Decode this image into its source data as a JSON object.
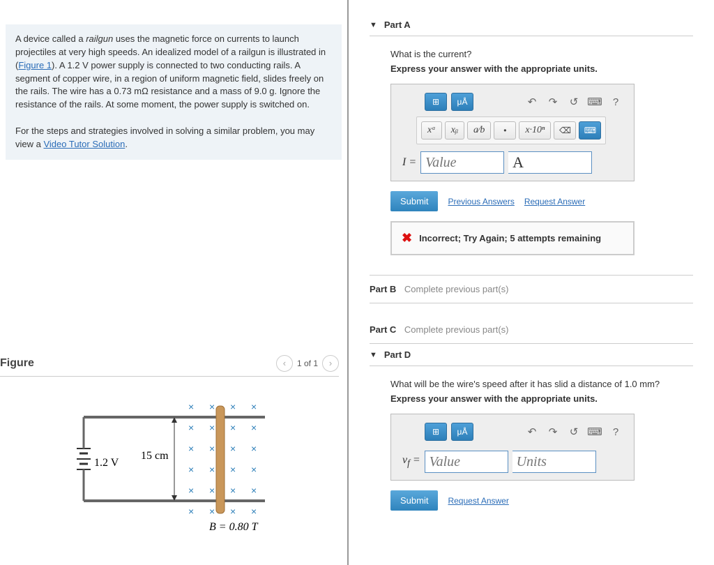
{
  "intro": {
    "text": "A device called a railgun uses the magnetic force on currents to launch projectiles at very high speeds. An idealized model of a railgun is illustrated in (Figure 1). A 1.2 V power supply is connected to two conducting rails. A segment of copper wire, in a region of uniform magnetic field, slides freely on the rails. The wire has a 0.73 mΩ resistance and a mass of 9.0 g. Ignore the resistance of the rails. At some moment, the power supply is switched on.",
    "figure_link": "Figure 1",
    "steps_prefix": "For the steps and strategies involved in solving a similar problem, you may view a ",
    "video_link": "Video Tutor Solution",
    "steps_suffix": "."
  },
  "figure": {
    "title": "Figure",
    "pager": "1 of 1",
    "labels": {
      "voltage": "1.2 V",
      "length": "15 cm",
      "field": "B = 0.80 T"
    }
  },
  "partA": {
    "label": "Part A",
    "prompt": "What is the current?",
    "express": "Express your answer with the appropriate units.",
    "var": "I =",
    "value_ph": "Value",
    "unit_val": "A",
    "tb": {
      "units": "μÅ",
      "sup": "xᵃ",
      "sub": "xᵦ",
      "frac": "a⁄b",
      "dot": "•",
      "sci": "x·10ⁿ"
    },
    "submit": "Submit",
    "prev": "Previous Answers",
    "req": "Request Answer",
    "feedback": "Incorrect; Try Again; 5 attempts remaining"
  },
  "partB": {
    "label": "Part B",
    "text": "Complete previous part(s)"
  },
  "partC": {
    "label": "Part C",
    "text": "Complete previous part(s)"
  },
  "partD": {
    "label": "Part D",
    "prompt": "What will be the wire's speed after it has slid a distance of 1.0 mm?",
    "express": "Express your answer with the appropriate units.",
    "var": "v_f =",
    "value_ph": "Value",
    "unit_ph": "Units",
    "submit": "Submit",
    "req": "Request Answer",
    "tb": {
      "units": "μÅ"
    }
  }
}
